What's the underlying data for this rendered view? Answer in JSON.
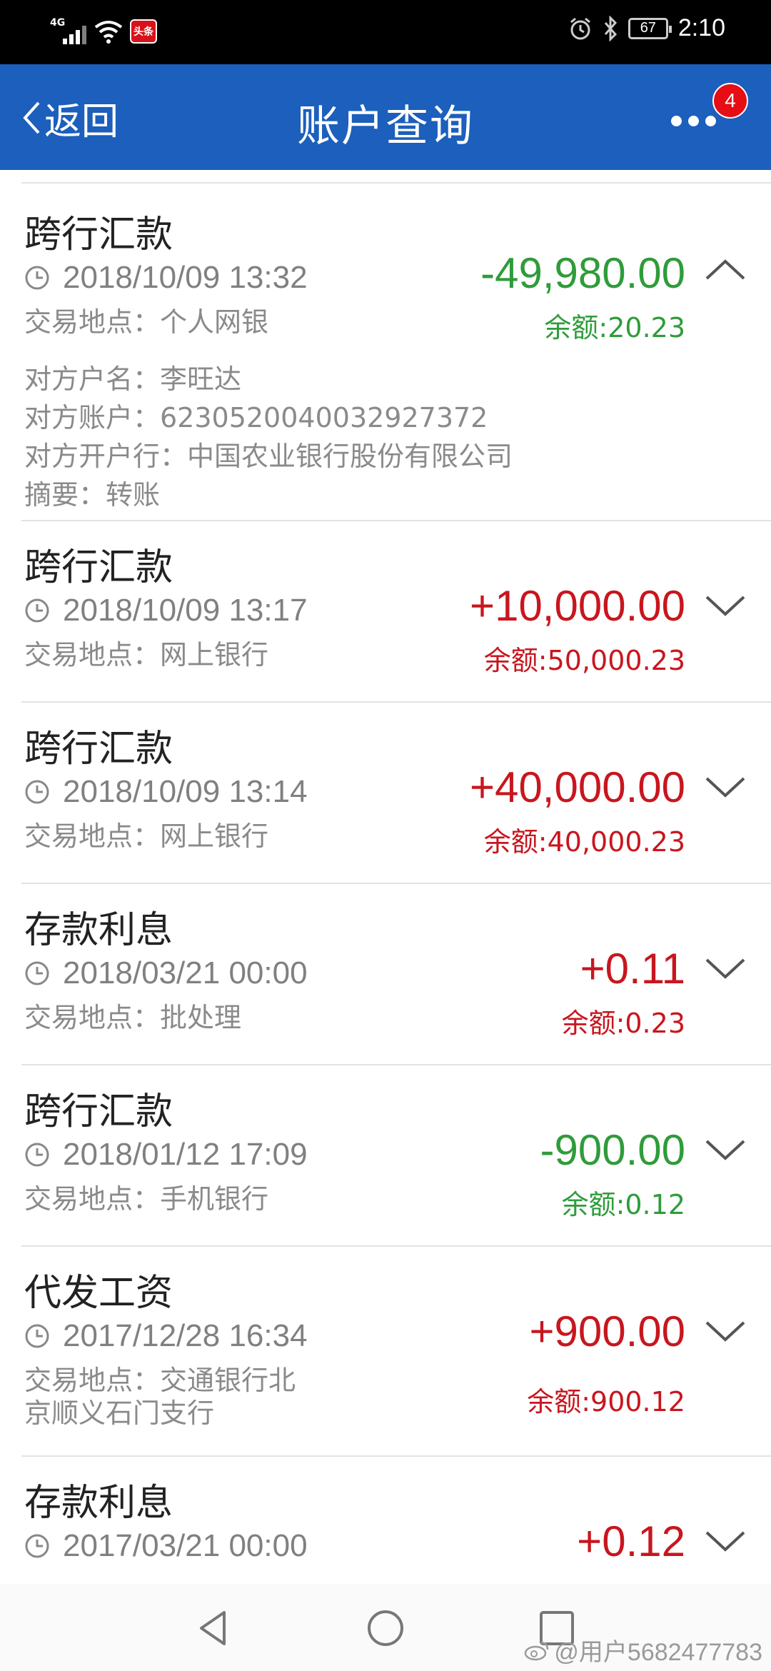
{
  "status_bar": {
    "network": "4G",
    "app_badge": "头条",
    "battery": "67",
    "time": "2:10"
  },
  "header": {
    "back_label": "返回",
    "title": "账户查询",
    "badge_count": "4"
  },
  "colors": {
    "header_bg": "#1c5fbc",
    "credit": "#c8161e",
    "debit": "#2f9c3a",
    "badge": "#e60d14"
  },
  "transactions": [
    {
      "type": "跨行汇款",
      "time": "2018/10/09 13:32",
      "location": "交易地点：个人网银",
      "amount": "-49,980.00",
      "balance": "余额:20.23",
      "direction": "debit",
      "expanded": true,
      "details": [
        "对方户名：李旺达",
        "对方账户：6230520040032927372",
        "对方开户行：中国农业银行股份有限公司",
        "摘要：转账"
      ]
    },
    {
      "type": "跨行汇款",
      "time": "2018/10/09 13:17",
      "location": "交易地点：网上银行",
      "amount": "+10,000.00",
      "balance": "余额:50,000.23",
      "direction": "credit",
      "expanded": false
    },
    {
      "type": "跨行汇款",
      "time": "2018/10/09 13:14",
      "location": "交易地点：网上银行",
      "amount": "+40,000.00",
      "balance": "余额:40,000.23",
      "direction": "credit",
      "expanded": false
    },
    {
      "type": "存款利息",
      "time": "2018/03/21 00:00",
      "location": "交易地点：批处理",
      "amount": "+0.11",
      "balance": "余额:0.23",
      "direction": "credit",
      "expanded": false
    },
    {
      "type": "跨行汇款",
      "time": "2018/01/12 17:09",
      "location": "交易地点：手机银行",
      "amount": "-900.00",
      "balance": "余额:0.12",
      "direction": "debit",
      "expanded": false
    },
    {
      "type": "代发工资",
      "time": "2017/12/28 16:34",
      "location_lines": [
        "交易地点：交通银行北",
        "京顺义石门支行"
      ],
      "amount": "+900.00",
      "balance": "余额:900.12",
      "direction": "credit",
      "expanded": false
    },
    {
      "type": "存款利息",
      "time": "2017/03/21 00:00",
      "amount": "+0.12",
      "direction": "credit",
      "expanded": false
    }
  ],
  "watermark": "@用户5682477783"
}
